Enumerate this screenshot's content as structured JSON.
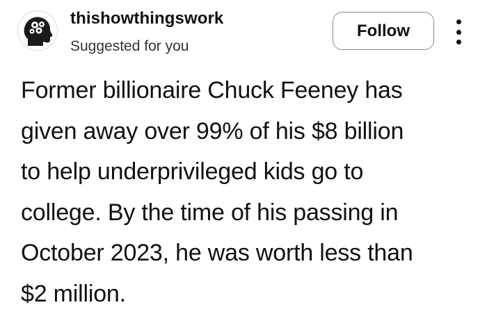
{
  "header": {
    "username": "thishowthingswork",
    "subtitle": "Suggested for you",
    "follow_label": "Follow",
    "avatar_icon": "head-gears-icon",
    "more_icon": "more-vertical-icon"
  },
  "post": {
    "lines": [
      "Former billionaire Chuck Feeney has",
      "given away over 99% of his $8 billion",
      "to help underprivileged kids go to",
      "college. By the time of his passing in",
      "October 2023, he was worth less than",
      "$2 million."
    ]
  }
}
